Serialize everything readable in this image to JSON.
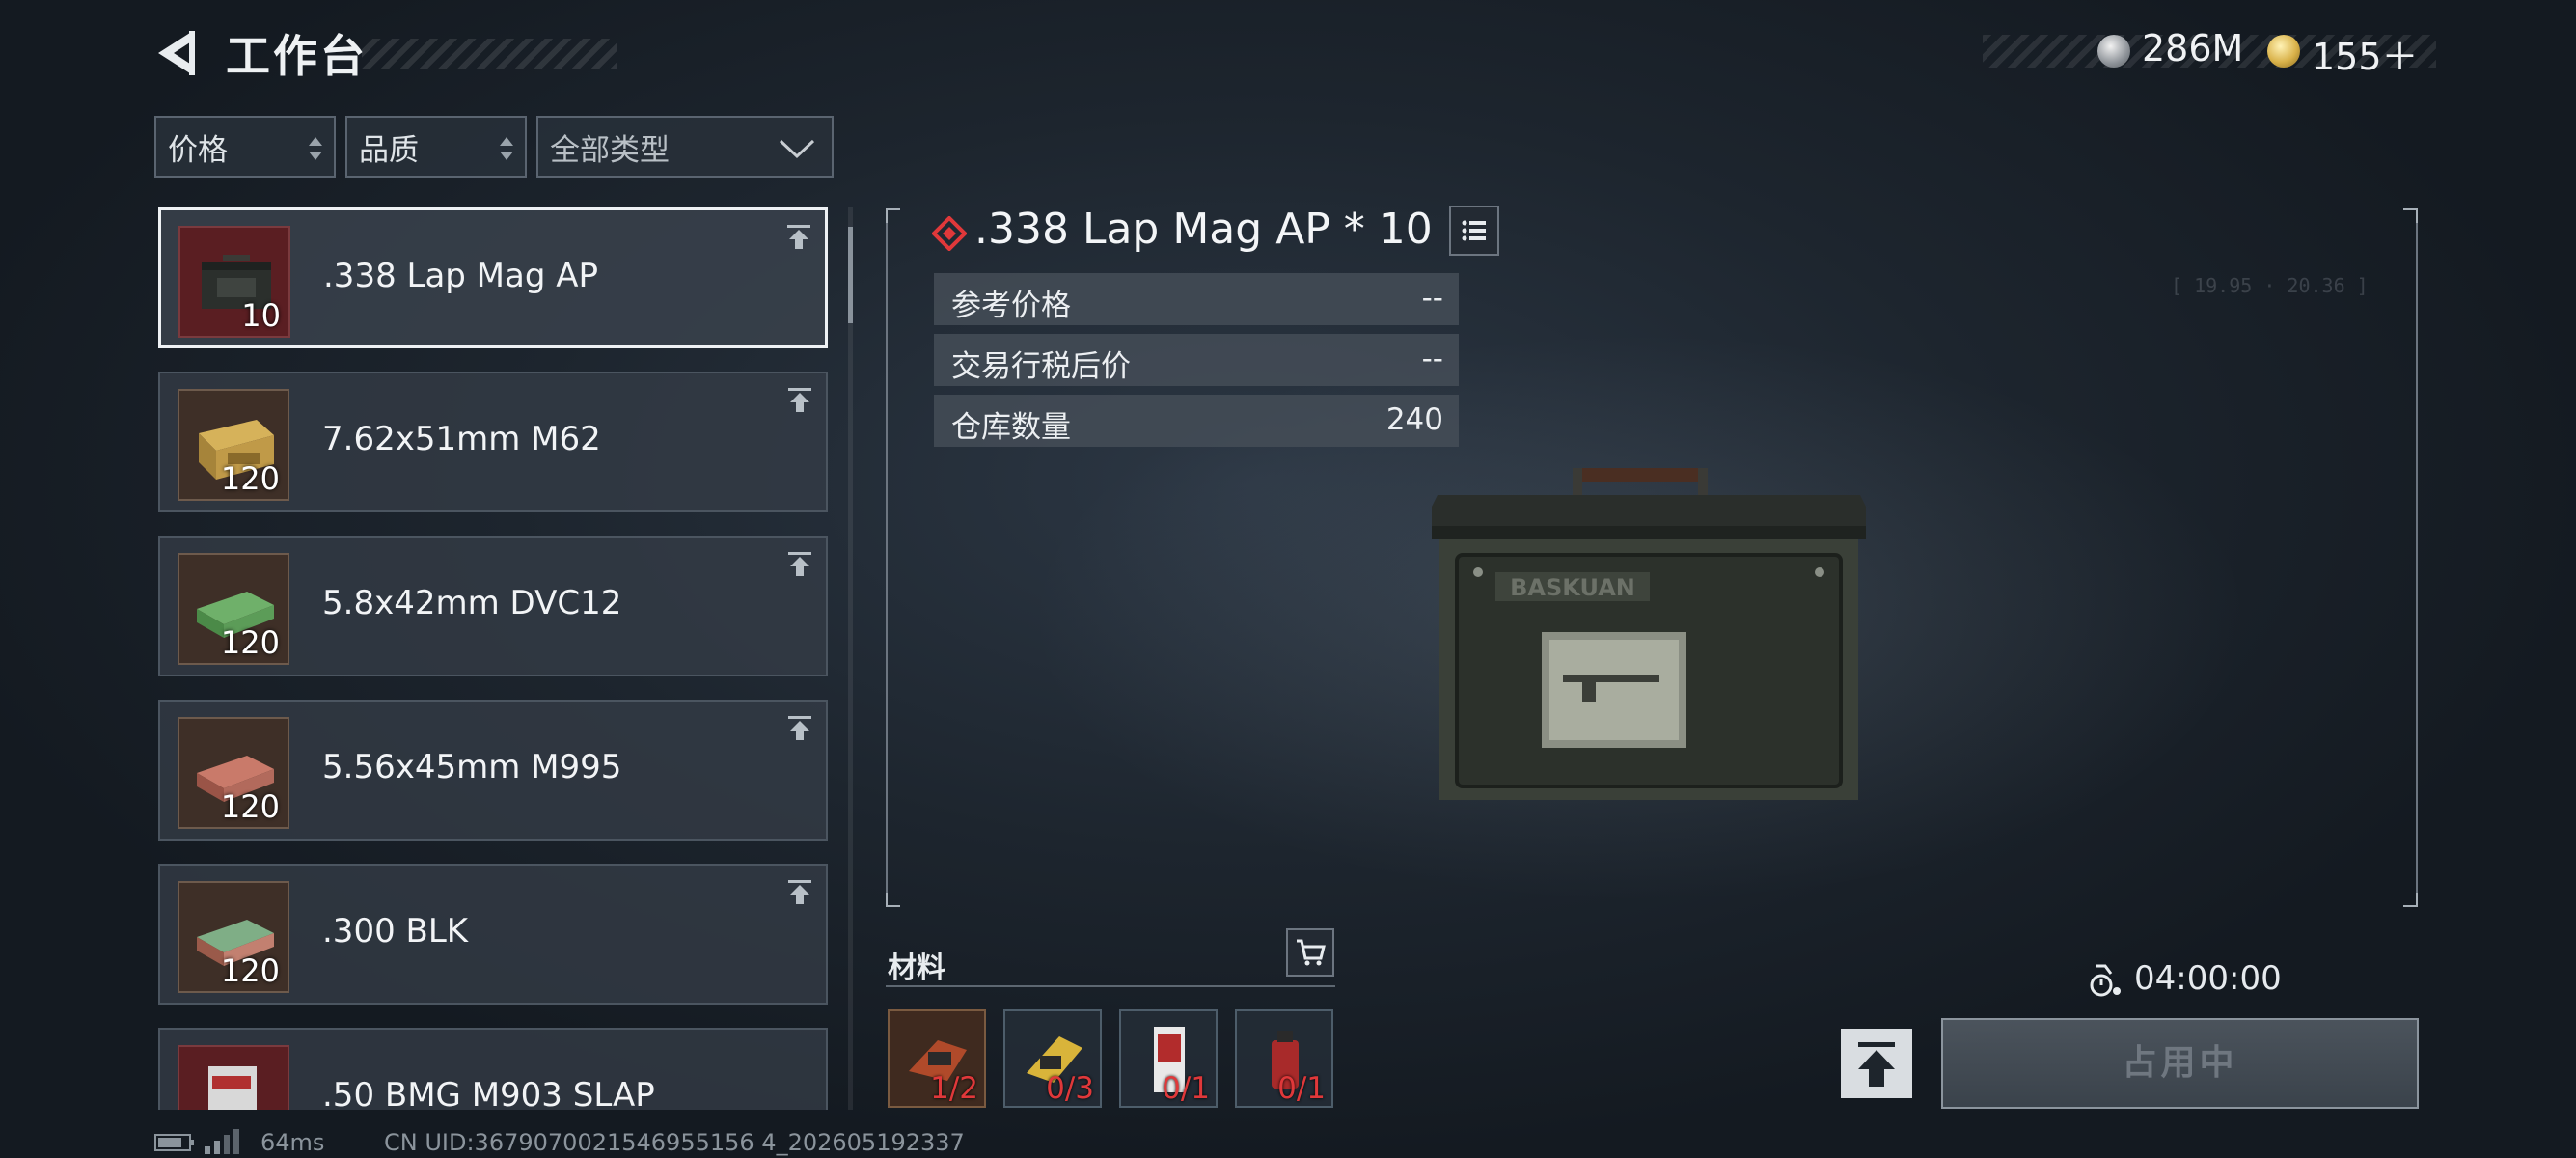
{
  "header": {
    "title": "工作台",
    "currency_silver": "286M",
    "currency_gold": "155＋"
  },
  "filters": {
    "price": "价格",
    "quality": "品质",
    "type": "全部类型"
  },
  "items": [
    {
      "name": ".338 Lap Mag AP",
      "qty": "10",
      "selected": true
    },
    {
      "name": "7.62x51mm M62",
      "qty": "120"
    },
    {
      "name": "5.8x42mm DVC12",
      "qty": "120"
    },
    {
      "name": "5.56x45mm M995",
      "qty": "120"
    },
    {
      "name": ".300 BLK",
      "qty": "120"
    },
    {
      "name": ".50 BMG M903 SLAP",
      "qty": ""
    }
  ],
  "detail": {
    "title": ".338 Lap Mag AP * 10",
    "stats": [
      {
        "label": "参考价格",
        "value": "--"
      },
      {
        "label": "交易行税后价",
        "value": "--"
      },
      {
        "label": "仓库数量",
        "value": "240"
      }
    ],
    "box_brand": "BASKUAN",
    "deco_range": "[ 19.95 · 20.36 ]"
  },
  "materials": {
    "label": "材料",
    "items": [
      {
        "count": "1/2"
      },
      {
        "count": "0/3"
      },
      {
        "count": "0/1"
      },
      {
        "count": "0/1"
      }
    ]
  },
  "craft": {
    "timer": "04:00:00",
    "status_button": "占用中"
  },
  "footer": {
    "ping": "64ms",
    "uid": "CN UID:3679070021546955156 4_202605192337"
  },
  "colors": {
    "rarity_red": "#e0383a",
    "accent_gold": "#d9b24a"
  }
}
